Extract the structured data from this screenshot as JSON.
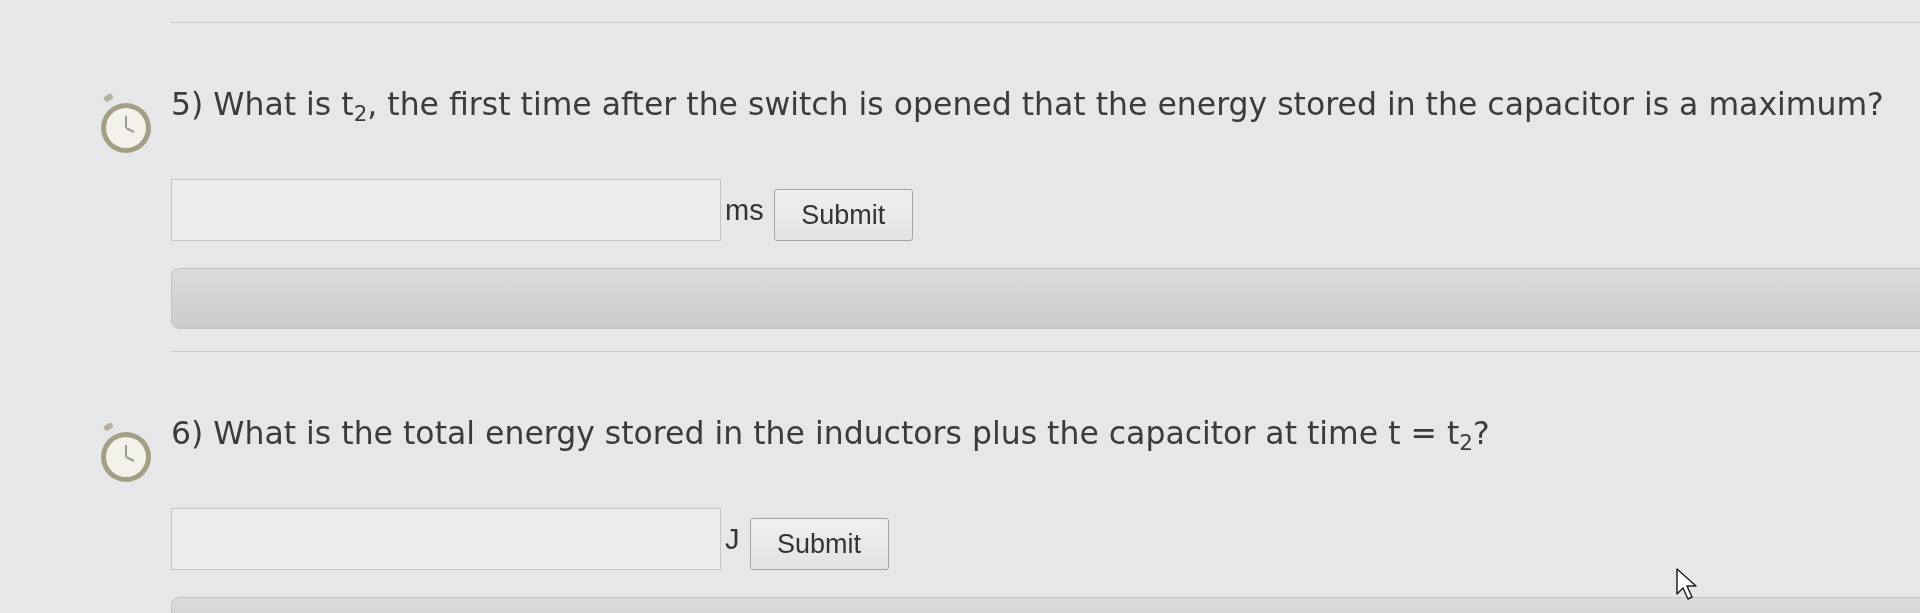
{
  "questions": [
    {
      "text": "5) What is t$_{2}$, the first time after the switch is opened that the energy stored in the capacitor is a maximum?",
      "unit": "ms",
      "button": "Submit"
    },
    {
      "text": "6) What is the total energy stored in the inductors plus the capacitor at time t = t$_{2}$?",
      "unit": "J",
      "button": "Submit"
    }
  ]
}
